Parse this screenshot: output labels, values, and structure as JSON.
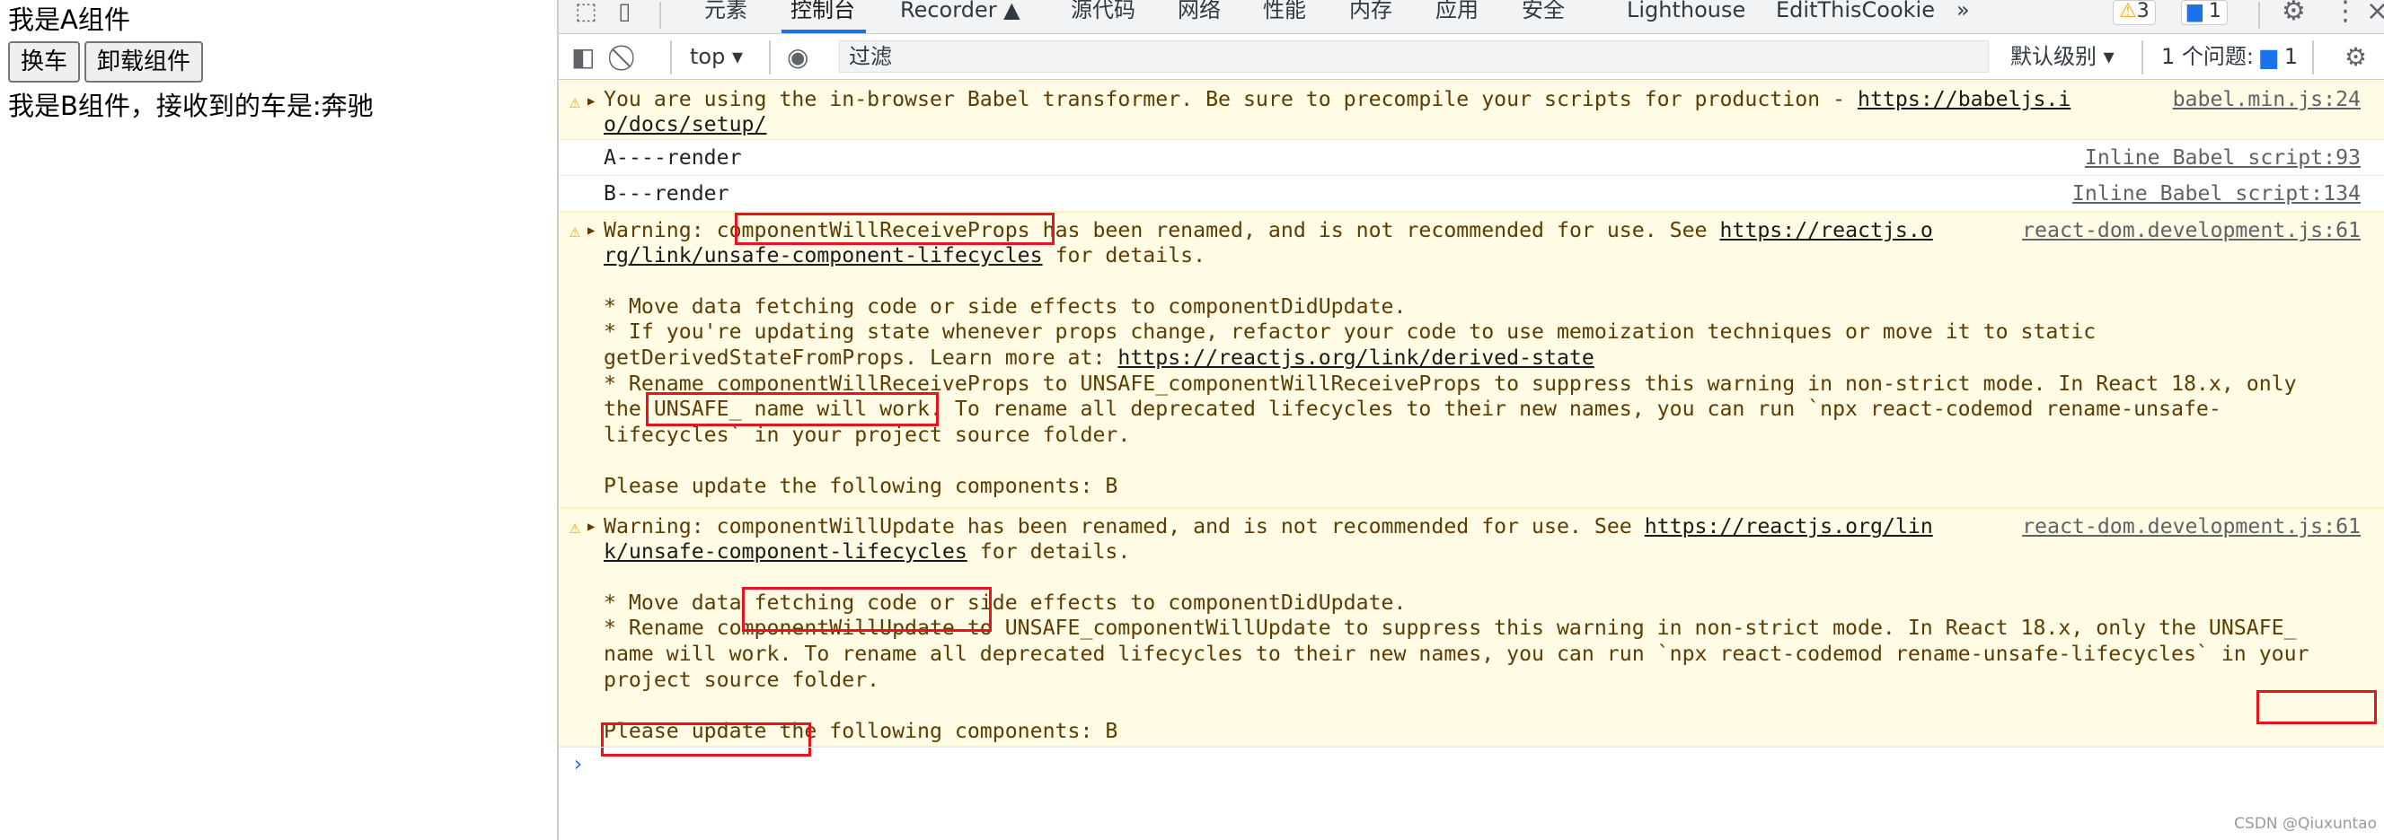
{
  "page": {
    "title_a": "我是A组件",
    "btn_change": "换车",
    "btn_unload": "卸载组件",
    "text_b": "我是B组件，接收到的车是:奔驰"
  },
  "devtools": {
    "tabs": [
      "元素",
      "控制台",
      "Recorder ▲",
      "源代码",
      "网络",
      "性能",
      "内存",
      "应用",
      "安全",
      "Lighthouse",
      "EditThisCookie"
    ],
    "more_tabs": "»",
    "warn_badge": "3",
    "msg_badge": "1",
    "toolbar": {
      "context": "top",
      "filter_placeholder": "过滤",
      "level": "默认级别",
      "issues_label": "1 个问题:",
      "issues_count": "1"
    }
  },
  "console": {
    "msg1": {
      "text_1": "You are using the in-browser Babel transformer. Be sure to precompile your scripts for production - ",
      "link_1a": "https://babeljs.i",
      "link_1b": "o/docs/setup/",
      "source": "babel.min.js:24"
    },
    "msg2": {
      "text": "A----render",
      "source": "Inline Babel script:93"
    },
    "msg3": {
      "text": "B---render",
      "source": "Inline Babel script:134"
    },
    "msg4": {
      "l1_pre": "Warning: ",
      "l1_hl": "componentWillReceiveProps",
      "l1_post": " has been renamed, and is not recommended for use. See ",
      "l1_link": "https://reactjs.o",
      "l2_link": "rg/link/unsafe-component-lifecycles",
      "l2_post": " for details.",
      "l3": "* Move data fetching code or side effects to componentDidUpdate.",
      "l4": "* If you're updating state whenever props change, refactor your code to use memoization techniques or move it to static",
      "l5_pre": "getDerivedStateFromProps. Learn more at: ",
      "l5_link": "https://reactjs.org/link/derived-state",
      "l6": "* Rename componentWillReceiveProps to UNSAFE_componentWillReceiveProps to suppress this warning in non-strict mode. In React 18.x, only",
      "l7": "the UNSAFE_ name will work. To rename all deprecated lifecycles to their new names, you can run `npx react-codemod rename-unsafe-",
      "l8": "lifecycles` in your project source folder.",
      "l9": "Please update the following components: B",
      "source": "react-dom.development.js:61"
    },
    "msg5": {
      "l1_pre": "Warning: ",
      "l1_hl": "componentWillUpdate",
      "l1_post": " has been renamed, and is not recommended for use. See ",
      "l1_link": "https://reactjs.org/lin",
      "l2_link": "k/unsafe-component-lifecycles",
      "l2_post": " for details.",
      "l3": "* Move data fetching code or side effects to componentDidUpdate.",
      "l4": "* Rename componentWillUpdate to UNSAFE_componentWillUpdate to suppress this warning in non-strict mode. In React 18.x, only the UNSAFE_",
      "l5": "name will work. To rename all deprecated lifecycles to their new names, you can run `npx react-codemod rename-unsafe-lifecycles` in your",
      "l6": "project source folder.",
      "l7": "Please update the following components: B",
      "source": "react-dom.development.js:61"
    },
    "prompt": "›"
  },
  "watermark": "CSDN @Qiuxuntao",
  "colors": {
    "accent": "#1a73e8",
    "warning_bg": "#fffbe5",
    "highlight_box": "#e8131d"
  }
}
